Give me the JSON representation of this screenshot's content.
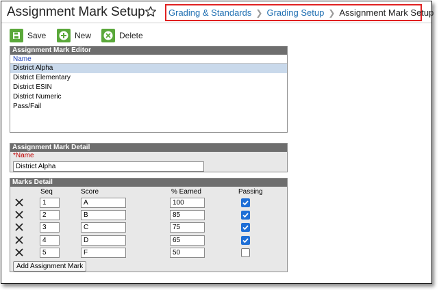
{
  "header": {
    "title": "Assignment Mark Setup",
    "breadcrumb": {
      "items": [
        "Grading & Standards",
        "Grading Setup"
      ],
      "current": "Assignment Mark Setup",
      "highlight_color": "#e02020"
    }
  },
  "toolbar": {
    "save_label": "Save",
    "new_label": "New",
    "delete_label": "Delete",
    "icon_color": "#5aa83a"
  },
  "editor": {
    "title": "Assignment Mark Editor",
    "column_header": "Name",
    "items": [
      "District Alpha",
      "District Elementary",
      "District ESIN",
      "District Numeric",
      "Pass/Fail"
    ],
    "selected": "District Alpha"
  },
  "detail": {
    "title": "Assignment Mark Detail",
    "name_label": "*Name",
    "name_value": "District Alpha"
  },
  "marks": {
    "title": "Marks Detail",
    "columns": {
      "seq": "Seq",
      "score": "Score",
      "earned": "% Earned",
      "passing": "Passing"
    },
    "rows": [
      {
        "seq": "1",
        "score": "A",
        "earned": "100",
        "passing": true
      },
      {
        "seq": "2",
        "score": "B",
        "earned": "85",
        "passing": true
      },
      {
        "seq": "3",
        "score": "C",
        "earned": "75",
        "passing": true
      },
      {
        "seq": "4",
        "score": "D",
        "earned": "65",
        "passing": true
      },
      {
        "seq": "5",
        "score": "F",
        "earned": "50",
        "passing": false
      }
    ],
    "add_label": "Add Assignment Mark"
  }
}
